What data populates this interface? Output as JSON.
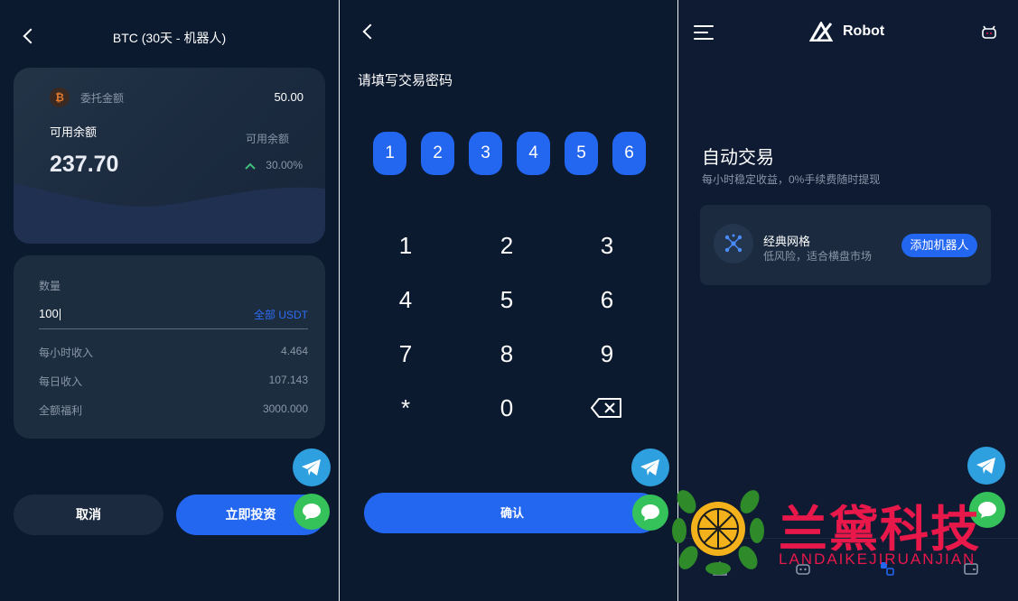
{
  "screen1": {
    "title": "BTC (30天 - 机器人)",
    "coin_symbol": "₿",
    "entrusted_label": "委托金额",
    "entrusted_value": "50.00",
    "available_label": "可用余额",
    "available_value": "237.70",
    "available_label_right": "可用余额",
    "change_pct": "30.00%",
    "quantity_label": "数量",
    "quantity_value": "100",
    "all_label": "全部 USDT",
    "rows": [
      {
        "label": "每小时收入",
        "value": "4.464"
      },
      {
        "label": "每日收入",
        "value": "107.143"
      },
      {
        "label": "全额福利",
        "value": "3000.000"
      }
    ],
    "cancel_label": "取消",
    "invest_label": "立即投资"
  },
  "screen2": {
    "title": "请填写交易密码",
    "pin_digits": [
      "1",
      "2",
      "3",
      "4",
      "5",
      "6"
    ],
    "keys": [
      "1",
      "2",
      "3",
      "4",
      "5",
      "6",
      "7",
      "8",
      "9",
      "*",
      "0"
    ],
    "confirm_label": "确认"
  },
  "screen3": {
    "brand": "Robot",
    "heading": "自动交易",
    "subheading": "每小时稳定收益，0%手续费随时提现",
    "strategy_name": "经典网格",
    "strategy_desc": "低风险，适合横盘市场",
    "add_label": "添加机器人"
  },
  "watermark": {
    "cn": "兰黛科技",
    "en": "LANDAIKEJIRUANJIAN"
  },
  "colors": {
    "accent": "#2366f0",
    "background": "#0c1a30",
    "telegram": "#2fa0df",
    "chat": "#36c25a",
    "watermark": "#e8184a"
  },
  "icons": [
    "back-icon",
    "bitcoin-icon",
    "arrow-up-icon",
    "telegram-icon",
    "chat-icon",
    "backspace-icon",
    "menu-icon",
    "robot-logo-icon",
    "bot-icon",
    "grid-icon",
    "home-icon",
    "robot-nav-icon",
    "orders-icon",
    "wallet-icon"
  ]
}
